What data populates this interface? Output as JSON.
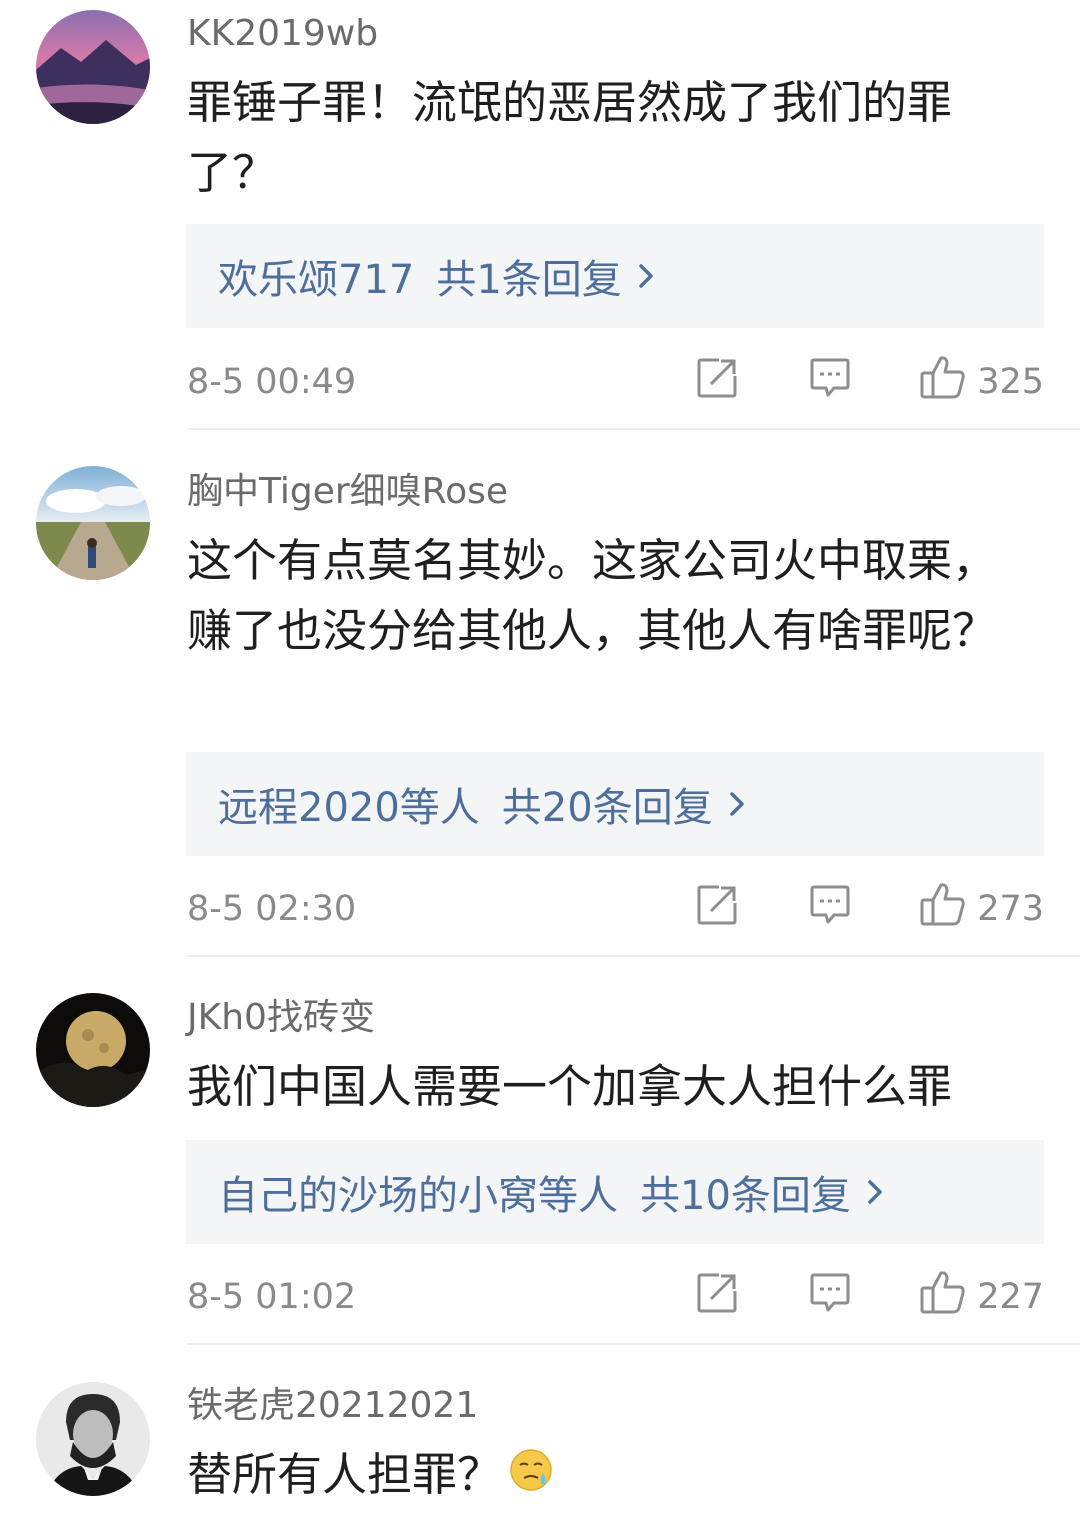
{
  "comments": [
    {
      "username": "KK2019wb",
      "text": "罪锤子罪！流氓的恶居然成了我们的罪了？",
      "reply_names": "欢乐颂717",
      "reply_count": "共1条回复",
      "time": "8-5 00:49",
      "likes": "325"
    },
    {
      "username": "胸中Tiger细嗅Rose",
      "text": "这个有点莫名其妙。这家公司火中取栗，赚了也没分给其他人，其他人有啥罪呢？",
      "reply_names": "远程2020等人",
      "reply_count": "共20条回复",
      "time": "8-5 02:30",
      "likes": "273"
    },
    {
      "username": "JKh0找砖变",
      "text": "我们中国人需要一个加拿大人担什么罪",
      "reply_names": "自己的沙场的小窝等人",
      "reply_count": "共10条回复",
      "time": "8-5 01:02",
      "likes": "227"
    },
    {
      "username": "铁老虎20212021",
      "text": "替所有人担罪？"
    }
  ],
  "icons": {
    "share": "share-icon",
    "comment": "comment-icon",
    "like": "thumbs-up-icon",
    "chevron": "chevron-right-icon",
    "emoji": "cold-sweat-emoji-icon"
  },
  "colors": {
    "link": "#4e6f9c",
    "meta": "#8a8a8a",
    "username": "#6b6b6b",
    "reply_bg": "#f4f5f7"
  }
}
